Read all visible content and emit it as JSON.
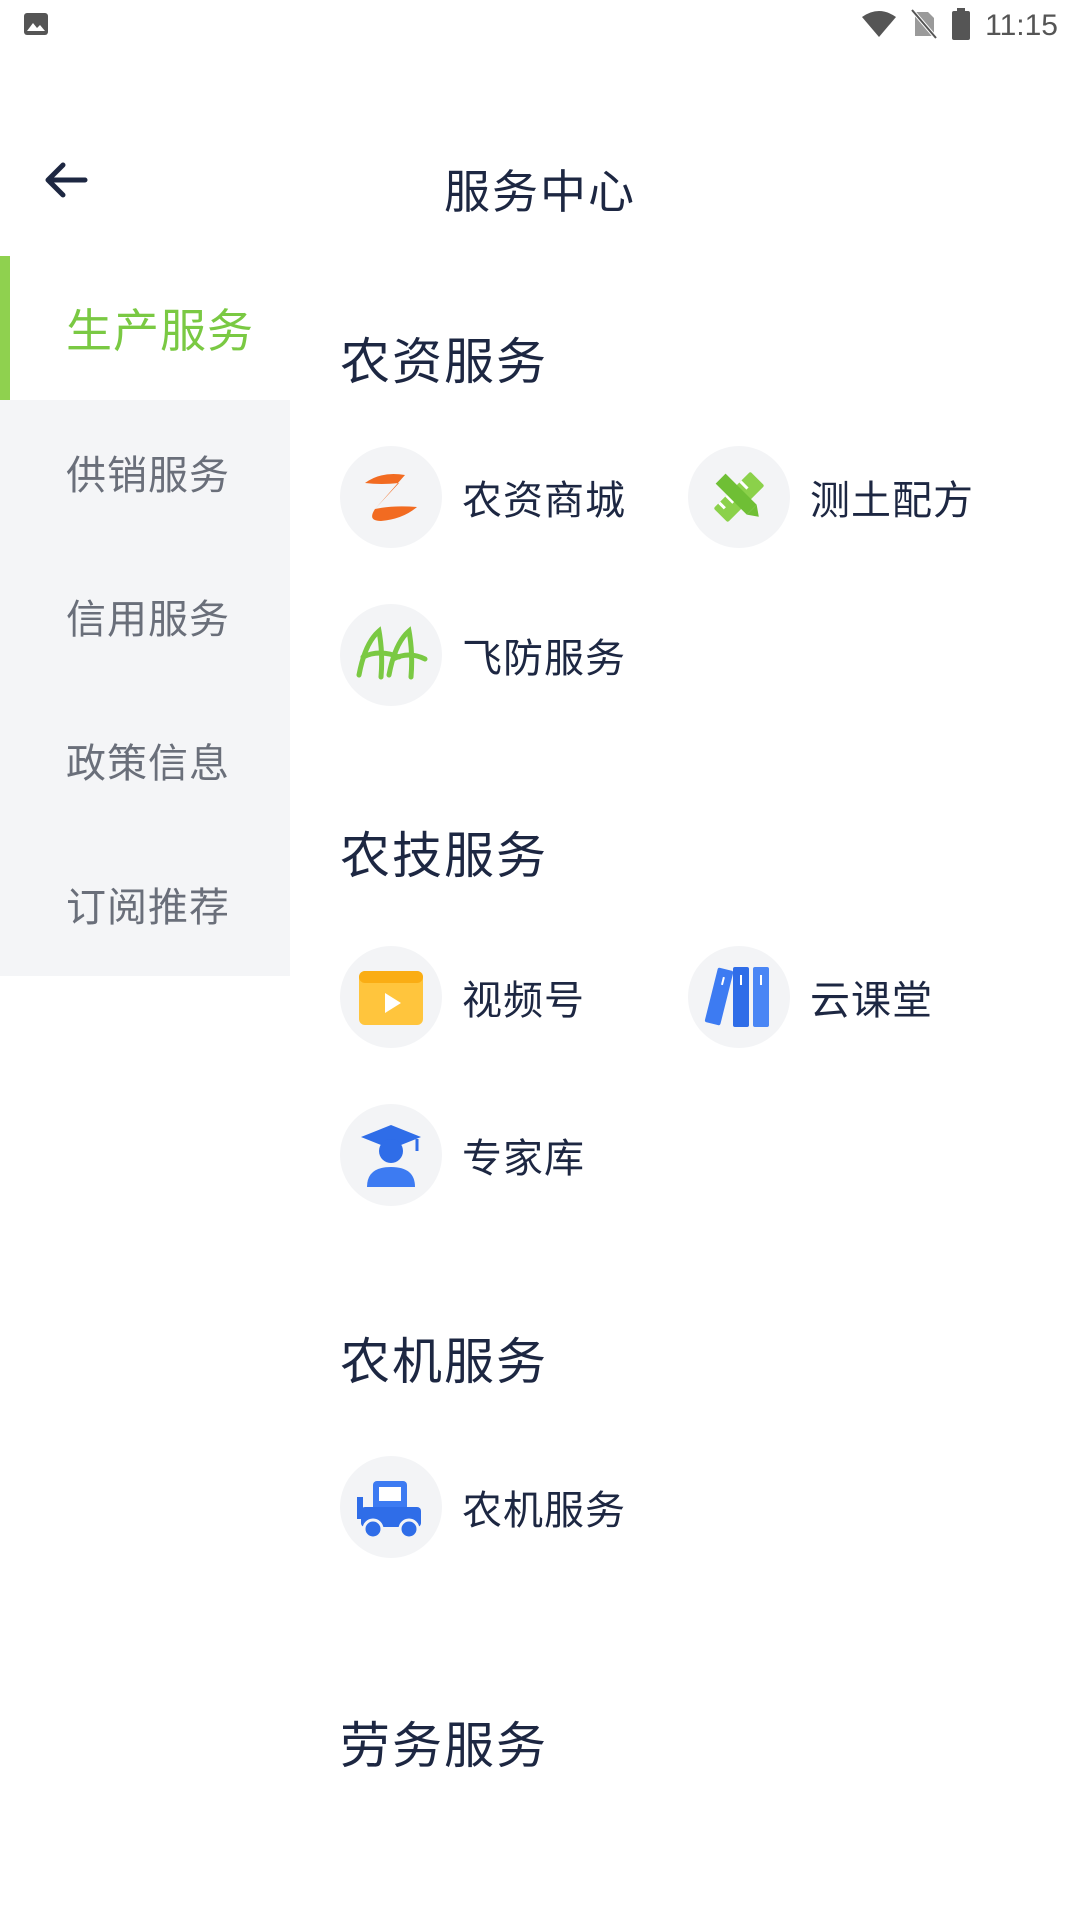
{
  "status_bar": {
    "time": "11:15",
    "icons": [
      "image-icon",
      "wifi-icon",
      "no-sim-icon",
      "battery-icon"
    ]
  },
  "header": {
    "title": "服务中心",
    "back_icon": "arrow-left-icon"
  },
  "sidebar": {
    "items": [
      {
        "label": "生产服务",
        "active": true
      },
      {
        "label": "供销服务",
        "active": false
      },
      {
        "label": "信用服务",
        "active": false
      },
      {
        "label": "政策信息",
        "active": false
      },
      {
        "label": "订阅推荐",
        "active": false
      }
    ]
  },
  "sections": [
    {
      "title": "农资服务",
      "items": [
        {
          "label": "农资商城",
          "icon": "mall-logo-icon"
        },
        {
          "label": "测土配方",
          "icon": "ruler-pencil-icon"
        },
        {
          "label": "飞防服务",
          "icon": "drone-logo-icon"
        }
      ]
    },
    {
      "title": "农技服务",
      "items": [
        {
          "label": "视频号",
          "icon": "video-play-icon"
        },
        {
          "label": "云课堂",
          "icon": "books-icon"
        },
        {
          "label": "专家库",
          "icon": "graduate-icon"
        }
      ]
    },
    {
      "title": "农机服务",
      "items": [
        {
          "label": "农机服务",
          "icon": "tractor-icon"
        }
      ]
    },
    {
      "title": "劳务服务",
      "items": []
    }
  ],
  "colors": {
    "accent_green": "#7ac943",
    "sidebar_bg": "#f4f5f7",
    "icon_bg": "#f3f4f6",
    "text_dark": "#1d2742",
    "text_muted": "#6a6f7a"
  }
}
